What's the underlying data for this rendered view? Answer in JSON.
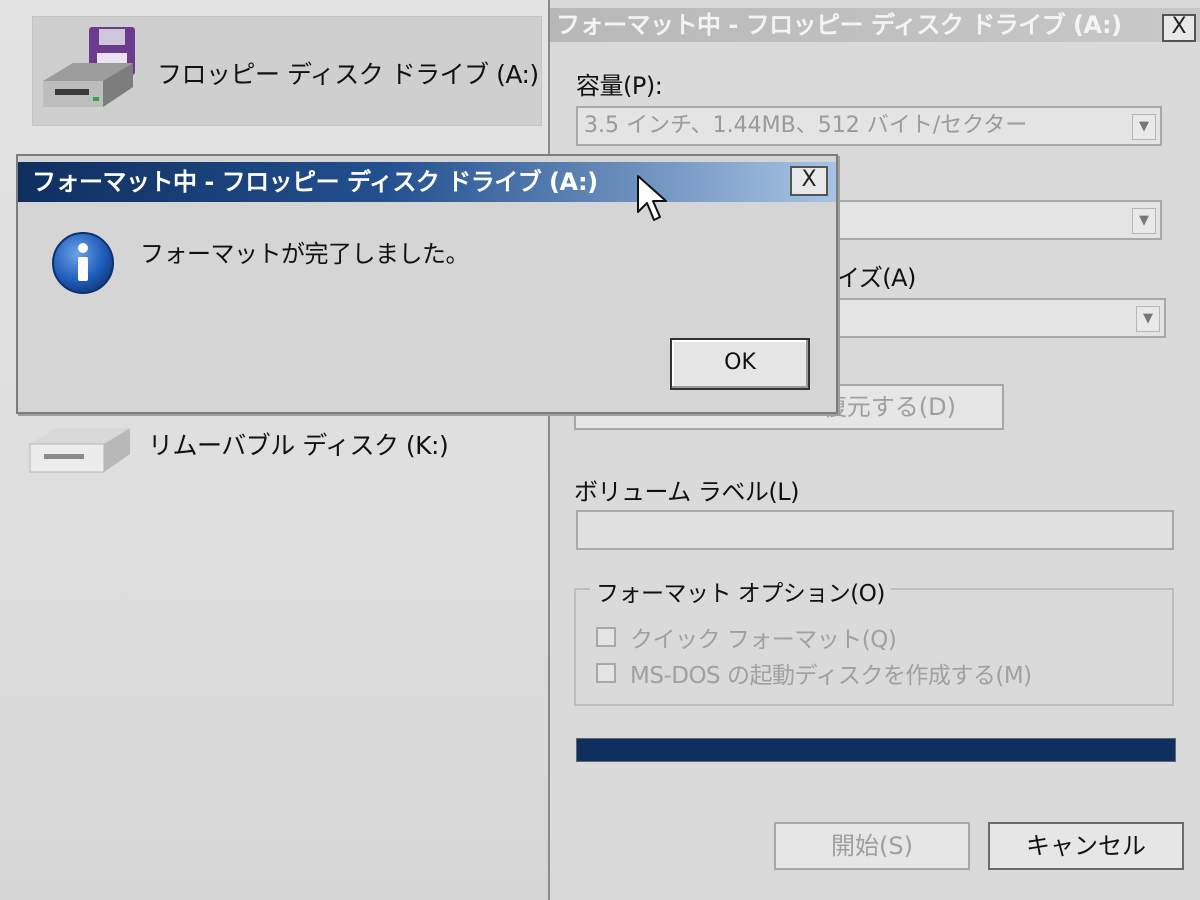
{
  "explorer": {
    "drives": [
      {
        "label": "フロッピー ディスク ドライブ (A:)",
        "icon": "floppy-drive-icon",
        "selected": true
      },
      {
        "label": "リムーバブル ディスク (K:)",
        "icon": "removable-drive-icon",
        "selected": false
      }
    ]
  },
  "format_dialog": {
    "title": "フォーマット中 - フロッピー ディスク ドライブ (A:)",
    "close_label": "X",
    "capacity_label": "容量(P):",
    "capacity_value": "3.5 インチ、1.44MB、512 バイト/セクター",
    "alloc_label_partial": "イズ(A)",
    "restore_button_partial": "復元する(D)",
    "volume_label": "ボリューム ラベル(L)",
    "volume_value": "",
    "options_group": "フォーマット オプション(O)",
    "quick_format": "クイック フォーマット(Q)",
    "msdos_boot": "MS-DOS の起動ディスクを作成する(M)",
    "progress": 1.0,
    "start_button": "開始(S)",
    "cancel_button": "キャンセル"
  },
  "message_box": {
    "title": "フォーマット中 - フロッピー ディスク ドライブ (A:)",
    "close_label": "X",
    "icon": "info-icon",
    "message": "フォーマットが完了しました。",
    "ok_button": "OK"
  },
  "colors": {
    "active_title_start": "#0f2f60",
    "active_title_end": "#a8c4e4",
    "progress_fill": "#0e2e5e"
  }
}
